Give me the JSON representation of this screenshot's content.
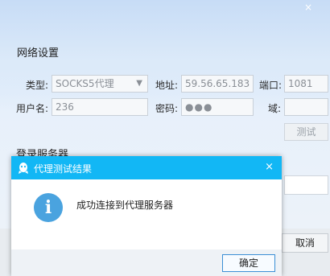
{
  "window": {
    "close_glyph": "×"
  },
  "settings": {
    "heading": "网络设置",
    "type_label": "类型:",
    "type_value": "SOCKS5代理",
    "address_label": "地址:",
    "address_value": "59.56.65.183",
    "port_label": "端口:",
    "port_value": "1081",
    "username_label": "用户名:",
    "username_value": "236",
    "password_label": "密码:",
    "password_value": "●●●",
    "domain_label": "域:",
    "domain_value": "",
    "test_button": "测试",
    "server_heading_partial": "登录服务器",
    "cancel_button": "取消"
  },
  "dialog": {
    "title": "代理测试结果",
    "close_glyph": "×",
    "message": "成功连接到代理服务器",
    "ok_button": "确定",
    "icon": "info-icon",
    "title_bar_color": "#12b7f5",
    "info_icon_color": "#4aa3df"
  }
}
